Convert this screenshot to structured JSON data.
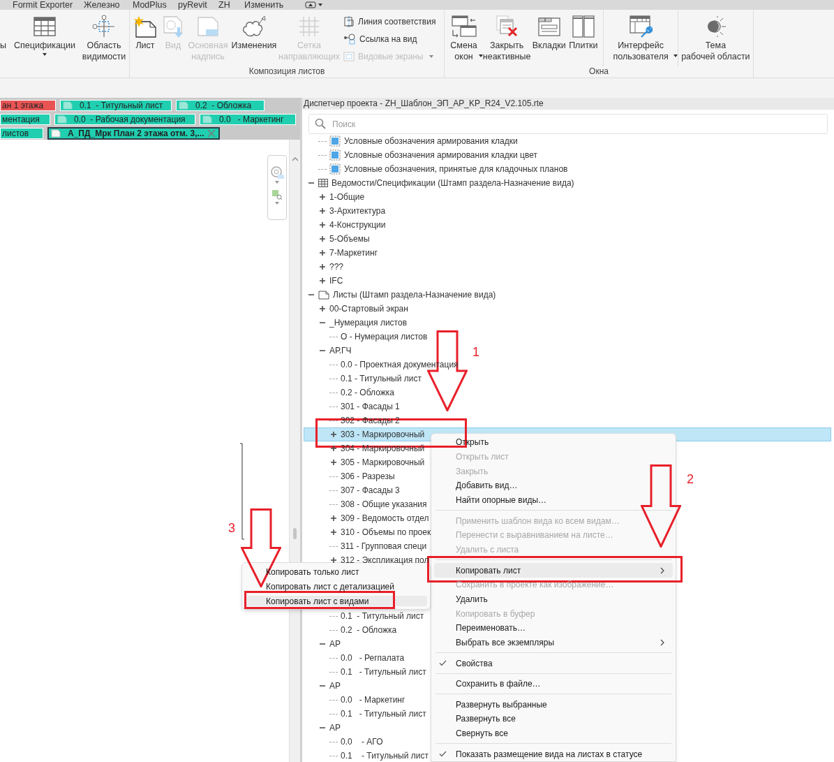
{
  "menu_tabs": [
    "Formit Exporter",
    "Железно",
    "ModPlus",
    "pyRevit",
    "ZH",
    "Изменить"
  ],
  "ribbon": {
    "panels": [
      {
        "buttons": [
          {
            "label": "ы",
            "disabled": false,
            "dropdown": false
          },
          {
            "label": "Спецификации",
            "disabled": false,
            "dropdown": true
          },
          {
            "label": "Область\nвидимости",
            "disabled": false,
            "dropdown": false
          }
        ]
      },
      {
        "label": "Композиция листов",
        "buttons": [
          {
            "label": "Лист",
            "disabled": false,
            "dropdown": false
          },
          {
            "label": "Вид",
            "disabled": true,
            "dropdown": false
          },
          {
            "label": "Основная\nнадпись",
            "disabled": true,
            "dropdown": false
          },
          {
            "label": "Изменения",
            "disabled": false,
            "dropdown": false
          },
          {
            "label": "Сетка\nнаправляющих",
            "disabled": true,
            "dropdown": false
          }
        ],
        "small_buttons": [
          {
            "label": "Линия соответствия",
            "disabled": false,
            "dropdown": false
          },
          {
            "label": "Ссылка на вид",
            "disabled": false,
            "dropdown": false
          },
          {
            "label": "Видовые экраны",
            "disabled": true,
            "dropdown": true
          }
        ]
      },
      {
        "label": "Окна",
        "buttons": [
          {
            "label": "Смена\nокон",
            "disabled": false,
            "dropdown": true
          },
          {
            "label": "Закрыть\nнеактивные",
            "disabled": false,
            "dropdown": false
          },
          {
            "label": "Вкладки",
            "disabled": false,
            "dropdown": false
          },
          {
            "label": "Плитки",
            "disabled": false,
            "dropdown": false
          },
          {
            "label": "Интерфейс\nпользователя",
            "disabled": false,
            "dropdown": true
          },
          {
            "label": "Тема\nрабочей области",
            "disabled": false,
            "dropdown": false
          }
        ]
      }
    ]
  },
  "view_tabs": [
    [
      {
        "label": "ан 1 этажа",
        "color": "#e85454",
        "selected": false
      },
      {
        "label": "0.1  - Титульный лист",
        "color": "#20cfb0",
        "selected": false
      },
      {
        "label": "0.2  - Обложка",
        "color": "#20cfb0",
        "selected": false
      }
    ],
    [
      {
        "label": "ментация",
        "color": "#20cfb0",
        "selected": false
      },
      {
        "label": "0.0  - Рабочая документация",
        "color": "#20cfb0",
        "selected": false
      },
      {
        "label": "0.0   - Маркетинг",
        "color": "#20cfb0",
        "selected": false
      }
    ],
    [
      {
        "label": "листов",
        "color": "#20cfb0",
        "selected": false
      },
      {
        "label": "А_ПД_Мрк План 2 этажа отм. 3,...",
        "color": "#20cfb0",
        "selected": true
      }
    ]
  ],
  "project_browser": {
    "title": "Диспетчер проекта - ZH_Шаблон_ЭП_АР_KP_R24_V2.105.rte",
    "search": {
      "placeholder": "Поиск"
    },
    "tree": [
      {
        "kind": "hidden",
        "children": [
          {
            "kind": "legend",
            "label": "Условные обозначения армирования кладки",
            "selected": false
          },
          {
            "kind": "legend",
            "label": "Условные обозначения армирования кладки цвет",
            "selected": false
          },
          {
            "kind": "legend",
            "label": "Условные обозначения, принятые для кладочных планов",
            "selected": false
          }
        ]
      },
      {
        "kind": "schedules",
        "label": "Ведомости/Спецификации (Штамп раздела-Назначение вида)",
        "selected": false,
        "expanded": true,
        "children": [
          {
            "kind": "folder",
            "label": "1-Общие",
            "selected": false,
            "expanded": false
          },
          {
            "kind": "folder",
            "label": "3-Архитектура",
            "selected": false,
            "expanded": false
          },
          {
            "kind": "folder",
            "label": "4-Конструкции",
            "selected": false,
            "expanded": false
          },
          {
            "kind": "folder",
            "label": "5-Объемы",
            "selected": false,
            "expanded": false
          },
          {
            "kind": "folder",
            "label": "7-Маркетинг",
            "selected": false,
            "expanded": false
          },
          {
            "kind": "folder",
            "label": "???",
            "selected": false,
            "expanded": false
          },
          {
            "kind": "folder",
            "label": "IFC",
            "selected": false,
            "expanded": false
          }
        ]
      },
      {
        "kind": "sheets",
        "label": "Листы (Штамп раздела-Назначение вида)",
        "selected": false,
        "expanded": true,
        "children": [
          {
            "kind": "folder",
            "label": "00-Стартовый экран",
            "selected": false,
            "expanded": false
          },
          {
            "kind": "folder",
            "label": "_Нумерация листов",
            "selected": false,
            "expanded": true,
            "children": [
              {
                "kind": "sheet",
                "label": "О - Нумерация листов",
                "selected": false
              }
            ]
          },
          {
            "kind": "folder",
            "label": "АР.ГЧ",
            "selected": false,
            "expanded": true,
            "children": [
              {
                "kind": "sheet",
                "label": "0.0 - Проектная документация",
                "selected": false
              },
              {
                "kind": "sheet",
                "label": "0.1 - Титульный лист",
                "selected": false
              },
              {
                "kind": "sheet",
                "label": "0.2 - Обложка",
                "selected": false
              },
              {
                "kind": "sheet",
                "label": "301 - Фасады 1",
                "selected": false
              },
              {
                "kind": "sheet",
                "label": "302 - Фасады 2",
                "selected": false
              },
              {
                "kind": "sheet",
                "label": "303 - Маркировочный",
                "selected": true,
                "expanded": false
              },
              {
                "kind": "sheet",
                "label": "304 - Маркировочный",
                "selected": false,
                "expanded": false
              },
              {
                "kind": "sheet",
                "label": "305 - Маркировочный",
                "selected": false,
                "expanded": false
              },
              {
                "kind": "sheet",
                "label": "306 - Разрезы",
                "selected": false
              },
              {
                "kind": "sheet",
                "label": "307 - Фасады 3",
                "selected": false
              },
              {
                "kind": "sheet",
                "label": "308 - Общие указания",
                "selected": false
              },
              {
                "kind": "sheet",
                "label": "309 - Ведомость отдел",
                "selected": false,
                "expanded": false
              },
              {
                "kind": "sheet",
                "label": "310 - Объемы по проек",
                "selected": false,
                "expanded": false
              },
              {
                "kind": "sheet",
                "label": "311 - Групповая специ",
                "selected": false
              },
              {
                "kind": "sheet",
                "label": "312 - Экспликация пол",
                "selected": false,
                "expanded": false
              }
            ]
          },
          {
            "kind": "covered",
            "children": [
              {
                "kind": "sheet",
                "label": "0.1  - Титульный лист",
                "selected": false
              },
              {
                "kind": "sheet",
                "label": "0.2  - Обложка",
                "selected": false
              }
            ]
          },
          {
            "kind": "folder",
            "label": "АР",
            "selected": false,
            "expanded": true,
            "children": [
              {
                "kind": "sheet",
                "label": "0.0   - Регпалата",
                "selected": false
              },
              {
                "kind": "sheet",
                "label": "0.1   - Титульный лист",
                "selected": false
              }
            ]
          },
          {
            "kind": "folder",
            "label": "АР",
            "selected": false,
            "expanded": true,
            "children": [
              {
                "kind": "sheet",
                "label": "0.0   - Маркетинг",
                "selected": false
              },
              {
                "kind": "sheet",
                "label": "0.1   - Титульный лист",
                "selected": false
              }
            ]
          },
          {
            "kind": "folder",
            "label": "АР",
            "selected": false,
            "expanded": true,
            "children": [
              {
                "kind": "sheet",
                "label": "0.0    - АГО",
                "selected": false
              },
              {
                "kind": "sheet",
                "label": "0.1    - Титульный лист",
                "selected": false
              }
            ]
          }
        ]
      }
    ]
  },
  "context_menu": {
    "items": [
      {
        "kind": "item",
        "label": "Открыть",
        "disabled": false,
        "highlighted": false,
        "checked": false,
        "submenu": false
      },
      {
        "kind": "item",
        "label": "Открыть лист",
        "disabled": true,
        "highlighted": false,
        "checked": false,
        "submenu": false
      },
      {
        "kind": "item",
        "label": "Закрыть",
        "disabled": true,
        "highlighted": false,
        "checked": false,
        "submenu": false
      },
      {
        "kind": "item",
        "label": "Добавить вид…",
        "disabled": false,
        "highlighted": false,
        "checked": false,
        "submenu": false
      },
      {
        "kind": "item",
        "label": "Найти опорные виды…",
        "disabled": false,
        "highlighted": false,
        "checked": false,
        "submenu": false
      },
      {
        "kind": "separator"
      },
      {
        "kind": "item",
        "label": "Применить шаблон вида ко всем видам…",
        "disabled": true,
        "highlighted": false,
        "checked": false,
        "submenu": false
      },
      {
        "kind": "item",
        "label": "Перенести с выравниванием на листе…",
        "disabled": true,
        "highlighted": false,
        "checked": false,
        "submenu": false
      },
      {
        "kind": "item",
        "label": "Удалить с листа",
        "disabled": true,
        "highlighted": false,
        "checked": false,
        "submenu": false
      },
      {
        "kind": "separator"
      },
      {
        "kind": "item",
        "label": "Копировать лист",
        "disabled": false,
        "highlighted": true,
        "checked": false,
        "submenu": true
      },
      {
        "kind": "item",
        "label": "Сохранить в проекте как изображение…",
        "disabled": true,
        "highlighted": false,
        "checked": false,
        "submenu": false
      },
      {
        "kind": "item",
        "label": "Удалить",
        "disabled": false,
        "highlighted": false,
        "checked": false,
        "submenu": false
      },
      {
        "kind": "item",
        "label": "Копировать в буфер",
        "disabled": true,
        "highlighted": false,
        "checked": false,
        "submenu": false
      },
      {
        "kind": "item",
        "label": "Переименовать…",
        "disabled": false,
        "highlighted": false,
        "checked": false,
        "submenu": false
      },
      {
        "kind": "item",
        "label": "Выбрать все экземпляры",
        "disabled": false,
        "highlighted": false,
        "checked": false,
        "submenu": true
      },
      {
        "kind": "separator"
      },
      {
        "kind": "item",
        "label": "Свойства",
        "disabled": false,
        "highlighted": false,
        "checked": true,
        "submenu": false
      },
      {
        "kind": "separator"
      },
      {
        "kind": "item",
        "label": "Сохранить в файле…",
        "disabled": false,
        "highlighted": false,
        "checked": false,
        "submenu": false
      },
      {
        "kind": "separator"
      },
      {
        "kind": "item",
        "label": "Развернуть выбранные",
        "disabled": false,
        "highlighted": false,
        "checked": false,
        "submenu": false
      },
      {
        "kind": "item",
        "label": "Развернуть все",
        "disabled": false,
        "highlighted": false,
        "checked": false,
        "submenu": false
      },
      {
        "kind": "item",
        "label": "Свернуть все",
        "disabled": false,
        "highlighted": false,
        "checked": false,
        "submenu": false
      },
      {
        "kind": "separator"
      },
      {
        "kind": "item",
        "label": "Показать размещение вида на листах в статусе",
        "disabled": false,
        "highlighted": false,
        "checked": true,
        "submenu": false
      }
    ]
  },
  "submenu": {
    "items": [
      {
        "label": "Копировать только лист",
        "highlighted": false
      },
      {
        "label": "Копировать лист с детализацией",
        "highlighted": false
      },
      {
        "label": "Копировать лист с видами",
        "highlighted": true
      }
    ]
  },
  "callouts": [
    {
      "number": "1"
    },
    {
      "number": "2"
    },
    {
      "number": "3"
    }
  ]
}
